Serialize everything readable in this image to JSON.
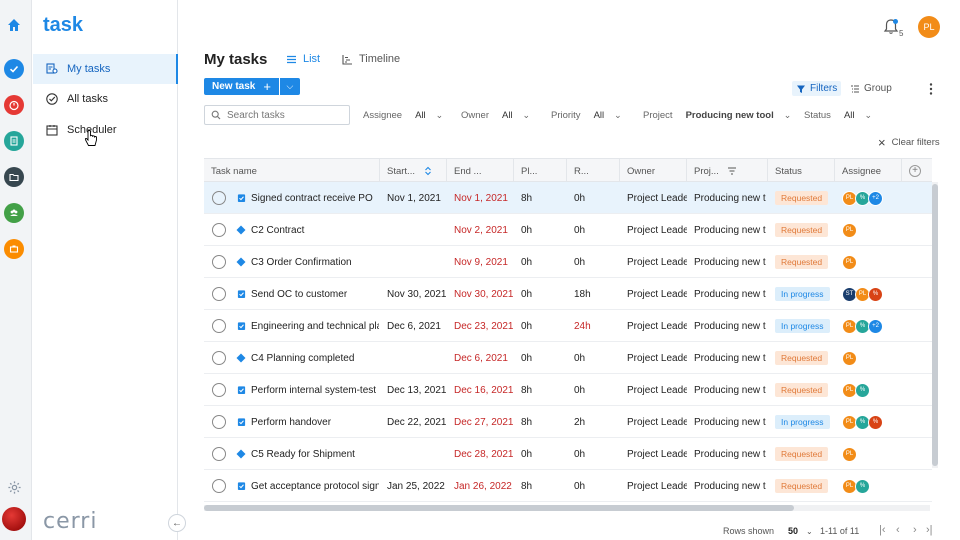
{
  "app": {
    "brand": "task",
    "logo": "cerri"
  },
  "sidebar": {
    "items": [
      {
        "label": "My tasks",
        "icon": "user-tasks-icon",
        "active": true
      },
      {
        "label": "All tasks",
        "icon": "check-circle-icon",
        "active": false
      },
      {
        "label": "Scheduler",
        "icon": "calendar-icon",
        "active": false
      }
    ]
  },
  "rail": {
    "icons": [
      "home-icon",
      "task-check-icon",
      "timer-icon",
      "report-icon",
      "folder-icon",
      "team-icon",
      "briefcase-icon",
      "gear-icon"
    ],
    "colors": {
      "task": "#1e88e5",
      "timer": "#e53935",
      "report": "#26a69a",
      "folder": "#37474f",
      "team": "#43a047",
      "briefcase": "#fb8c00"
    }
  },
  "header": {
    "title": "My tasks",
    "tabs": [
      {
        "label": "List",
        "active": true
      },
      {
        "label": "Timeline",
        "active": false
      }
    ],
    "notifications": "5",
    "user_initials": "PL"
  },
  "toolbar": {
    "new_task": "New task",
    "filters": "Filters",
    "group": "Group",
    "search_placeholder": "Search tasks",
    "clear_filters": "Clear filters"
  },
  "filters": [
    {
      "label": "Assignee",
      "value": "All"
    },
    {
      "label": "Owner",
      "value": "All"
    },
    {
      "label": "Priority",
      "value": "All"
    },
    {
      "label": "Project",
      "value": "Producing new tool"
    },
    {
      "label": "Status",
      "value": "All"
    }
  ],
  "table": {
    "columns": [
      "Task name",
      "Start...",
      "End ...",
      "Pl...",
      "R...",
      "Owner",
      "Proj...",
      "Status",
      "Assignee"
    ],
    "rows": [
      {
        "type": "task",
        "name": "Signed contract receive PO",
        "start": "Nov 1, 2021",
        "end": "Nov 1, 2021",
        "planned": "8h",
        "remaining": "0h",
        "remaining_red": false,
        "owner": "Project Leade",
        "project": "Producing new t",
        "status": "Requested",
        "assignees": [
          "PL",
          "%",
          "+2"
        ],
        "selected": true
      },
      {
        "type": "milestone",
        "name": "C2 Contract",
        "start": "",
        "end": "Nov 2, 2021",
        "planned": "0h",
        "remaining": "0h",
        "remaining_red": false,
        "owner": "Project Leade",
        "project": "Producing new t",
        "status": "Requested",
        "assignees": [
          "PL"
        ]
      },
      {
        "type": "milestone",
        "name": "C3 Order Confirmation",
        "start": "",
        "end": "Nov 9, 2021",
        "planned": "0h",
        "remaining": "0h",
        "remaining_red": false,
        "owner": "Project Leade",
        "project": "Producing new t",
        "status": "Requested",
        "assignees": [
          "PL"
        ]
      },
      {
        "type": "task",
        "name": "Send OC to customer",
        "start": "Nov 30, 2021",
        "end": "Nov 30, 2021",
        "planned": "0h",
        "remaining": "18h",
        "remaining_red": false,
        "owner": "Project Leade",
        "project": "Producing new t",
        "status": "In progress",
        "assignees": [
          "ST",
          "PL",
          "%"
        ]
      },
      {
        "type": "task",
        "name": "Engineering and technical pla",
        "start": "Dec 6, 2021",
        "end": "Dec 23, 2021",
        "planned": "0h",
        "remaining": "24h",
        "remaining_red": true,
        "owner": "Project Leade",
        "project": "Producing new t",
        "status": "In progress",
        "assignees": [
          "PL",
          "%",
          "+2"
        ]
      },
      {
        "type": "milestone",
        "name": "C4 Planning completed",
        "start": "",
        "end": "Dec 6, 2021",
        "planned": "0h",
        "remaining": "0h",
        "remaining_red": false,
        "owner": "Project Leade",
        "project": "Producing new t",
        "status": "Requested",
        "assignees": [
          "PL"
        ]
      },
      {
        "type": "task",
        "name": "Perform internal system-test",
        "start": "Dec 13, 2021",
        "end": "Dec 16, 2021",
        "planned": "8h",
        "remaining": "0h",
        "remaining_red": false,
        "owner": "Project Leade",
        "project": "Producing new t",
        "status": "Requested",
        "assignees": [
          "PL",
          "%"
        ]
      },
      {
        "type": "task",
        "name": "Perform handover",
        "start": "Dec 22, 2021",
        "end": "Dec 27, 2021",
        "planned": "8h",
        "remaining": "2h",
        "remaining_red": false,
        "owner": "Project Leade",
        "project": "Producing new t",
        "status": "In progress",
        "assignees": [
          "PL",
          "%",
          "%"
        ]
      },
      {
        "type": "milestone",
        "name": "C5 Ready for Shipment",
        "start": "",
        "end": "Dec 28, 2021",
        "planned": "0h",
        "remaining": "0h",
        "remaining_red": false,
        "owner": "Project Leade",
        "project": "Producing new t",
        "status": "Requested",
        "assignees": [
          "PL"
        ]
      },
      {
        "type": "task",
        "name": "Get acceptance protocol signe",
        "start": "Jan 25, 2022",
        "end": "Jan 26, 2022",
        "planned": "8h",
        "remaining": "0h",
        "remaining_red": false,
        "owner": "Project Leade",
        "project": "Producing new t",
        "status": "Requested",
        "assignees": [
          "PL",
          "%"
        ]
      }
    ]
  },
  "pagination": {
    "rows_label": "Rows shown",
    "rows_value": "50",
    "range": "1-11 of 11"
  }
}
